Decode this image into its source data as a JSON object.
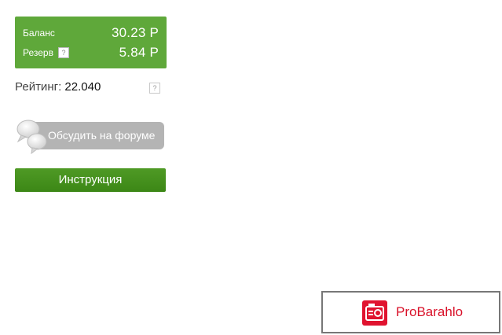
{
  "balance_box": {
    "background": "#5fa83a",
    "balance_label": "Баланс",
    "balance_value": "30.23 Р",
    "reserve_label": "Резерв",
    "reserve_help": "?",
    "reserve_value": "5.84 Р"
  },
  "rating": {
    "label": "Рейтинг:",
    "value": "22.040",
    "help": "?"
  },
  "forum_button": {
    "label": "Обсудить на форуме",
    "icon": "speech-bubbles-icon"
  },
  "instruction_button": {
    "label": "Инструкция",
    "color": "#3f8b19"
  },
  "watermark": {
    "text": "ProBarahlo",
    "icon": "camera-icon",
    "color": "#d9122a"
  }
}
